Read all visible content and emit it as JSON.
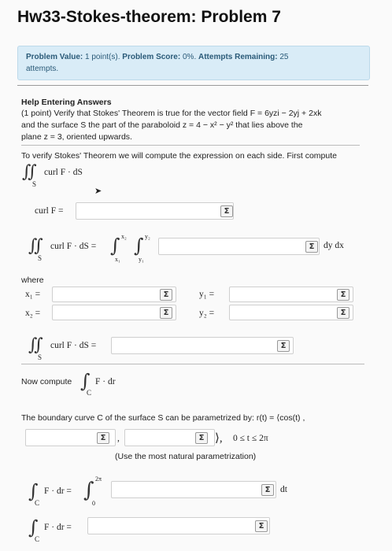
{
  "page": {
    "title": "Hw33-Stokes-theorem: Problem 7"
  },
  "info": {
    "problem_value_label": "Problem Value:",
    "problem_value": "1 point(s).",
    "score_label": "Problem Score:",
    "score": "0%.",
    "attempts_label": "Attempts Remaining:",
    "attempts": "25",
    "attempts_suffix": "attempts."
  },
  "help": {
    "heading": "Help Entering Answers",
    "line1": "(1 point) Verify that Stokes' Theorem is true for the vector field F = 6yzi − 2yj + 2xk",
    "line2": "and the surface S the part of the paraboloid z = 4 − x² − y² that lies above the",
    "line3": "plane z = 3, oriented upwards."
  },
  "content": {
    "intro": "To verify Stokes' Theorem we will compute the expression on each side. First compute",
    "double_int": "∬",
    "sub_s": "S",
    "curl_f_ds": "curl F · dS",
    "curl_f_label": "curl F =",
    "double_int_eq": "curl F · dS =",
    "int_sign": "∫",
    "x1": "x₁",
    "x2": "x₂",
    "y1": "y₁",
    "y2": "y₂",
    "dy_dx": "dy dx",
    "where": "where",
    "x1_eq": "x₁ =",
    "x2_eq": "x₂ =",
    "y1_eq": "y₁ =",
    "y2_eq": "y₂ =",
    "now_compute": "Now compute",
    "line_int": "∫",
    "sub_c": "C",
    "f_dr": "F · dr",
    "boundary": "The boundary curve C of the surface S can be parametrized by: r(t) = ⟨cos(t) ,",
    "comma": ",",
    "close_angle": "⟩,",
    "range": "0 ≤ t ≤ 2π",
    "hint": "(Use the most natural parametrization)",
    "f_dr_eq": "F · dr =",
    "upper_2pi": "2π",
    "lower_0": "0",
    "dt": "dt",
    "sigma": "Σ"
  }
}
